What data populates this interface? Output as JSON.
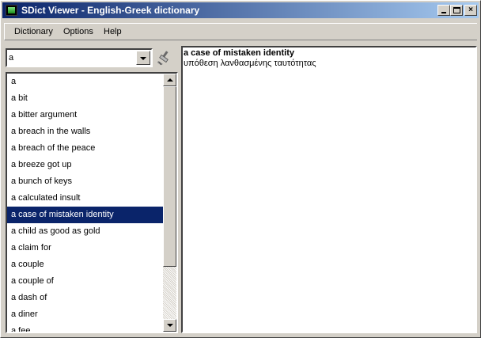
{
  "window": {
    "title": "SDict Viewer - English-Greek dictionary",
    "controls": {
      "minimize": "",
      "maximize": "",
      "close": "×"
    }
  },
  "menu": [
    "Dictionary",
    "Options",
    "Help"
  ],
  "search": {
    "value": "a"
  },
  "word_list": {
    "items": [
      "a",
      "a bit",
      "a bitter argument",
      "a breach in the walls",
      "a breach of the peace",
      "a breeze got up",
      "a bunch of keys",
      "a calculated insult",
      "a case of mistaken identity",
      "a child as good as gold",
      "a claim for",
      "a couple",
      "a couple of",
      "a dash of",
      "a diner",
      "a fee"
    ],
    "selected": "a case of mistaken identity"
  },
  "translation": {
    "headword": "a case of mistaken identity",
    "text": "υπόθεση λανθασμένης ταυτότητας"
  },
  "colors": {
    "selection": "#0a246a",
    "title_gradient_start": "#0a246a",
    "title_gradient_end": "#a6caf0"
  },
  "icons": {
    "app": "app-dictionary-icon",
    "clear": "brush-icon"
  }
}
